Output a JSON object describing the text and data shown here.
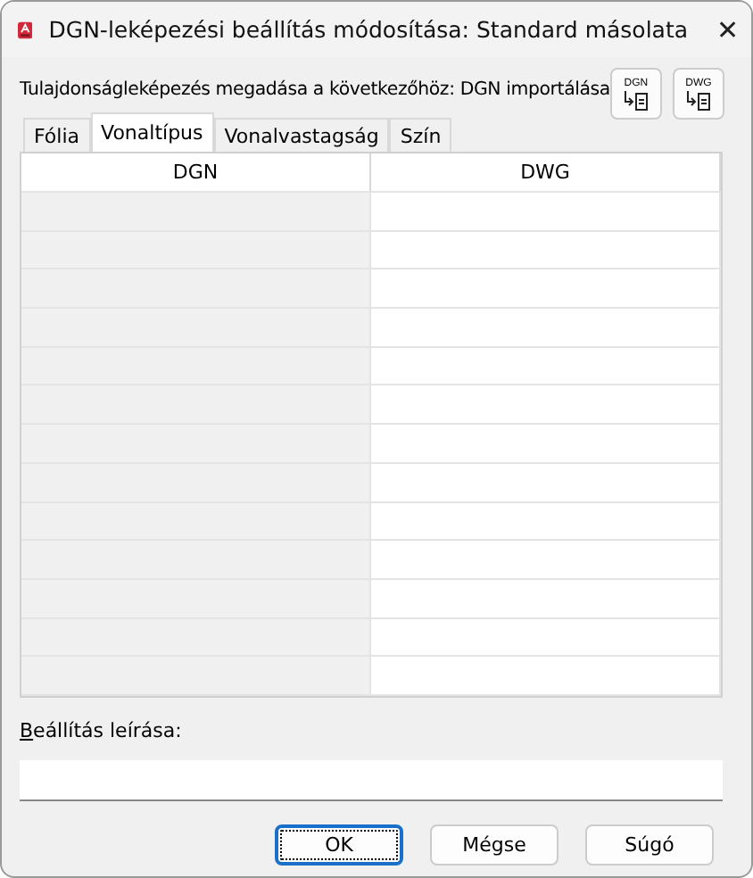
{
  "window": {
    "title": "DGN-leképezési beállítás módosítása: Standard másolata",
    "close": "✕"
  },
  "heading": "Tulajdonságleképezés megadása a következőhöz: DGN importálása",
  "tool_buttons": [
    {
      "label": "DGN"
    },
    {
      "label": "DWG"
    }
  ],
  "tabs": [
    {
      "label": "Fólia",
      "selected": false
    },
    {
      "label": "Vonaltípus",
      "selected": true
    },
    {
      "label": "Vonalvastagság",
      "selected": false
    },
    {
      "label": "Szín",
      "selected": false
    }
  ],
  "table": {
    "columns": [
      "DGN",
      "DWG"
    ]
  },
  "description": {
    "label": "Beállítás leírása:"
  },
  "buttons": [
    {
      "label": "OK",
      "focused": true
    },
    {
      "label": "Mégse",
      "focused": false
    },
    {
      "label": "Súgó",
      "focused": false
    }
  ]
}
